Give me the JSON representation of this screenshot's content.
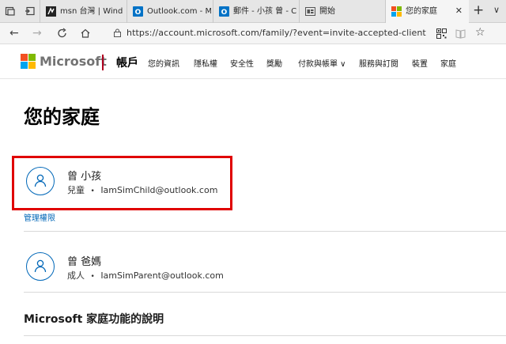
{
  "browser": {
    "tabs": [
      {
        "title": "msn 台灣 | Wind",
        "icon": "msn-icon"
      },
      {
        "title": "Outlook.com - M",
        "icon": "outlook-icon"
      },
      {
        "title": "郵件 - 小孩 曾 - C",
        "icon": "outlook-icon"
      },
      {
        "title": "開始",
        "icon": "start-page-icon"
      },
      {
        "title": "您的家庭",
        "icon": "microsoft-icon",
        "active": true
      }
    ],
    "close_label": "✕",
    "new_tab_label": "+",
    "tab_menu_label": "∨",
    "address": "https://account.microsoft.com/family/?event=invite-accepted-client"
  },
  "header": {
    "brand": "Microsoft",
    "section": "帳戶",
    "nav": [
      "您的資訊",
      "隱私權",
      "安全性",
      "獎勵",
      "付款與帳單 ∨",
      "服務與訂閱",
      "裝置",
      "家庭"
    ]
  },
  "page": {
    "title": "您的家庭",
    "members": [
      {
        "name": "曾 小孩",
        "role": "兒童",
        "email": "IamSimChild@outlook.com"
      },
      {
        "name": "曾 爸媽",
        "role": "成人",
        "email": "IamSimParent@outlook.com"
      }
    ],
    "separator": "•",
    "manage_link": "管理權限",
    "help_heading": "Microsoft 家庭功能的說明"
  },
  "colors": {
    "accent": "#0067b8",
    "highlight_box": "#e00000",
    "brand_red": "#f25022",
    "brand_green": "#7fba00",
    "brand_blue": "#00a4ef",
    "brand_yellow": "#ffb900"
  }
}
